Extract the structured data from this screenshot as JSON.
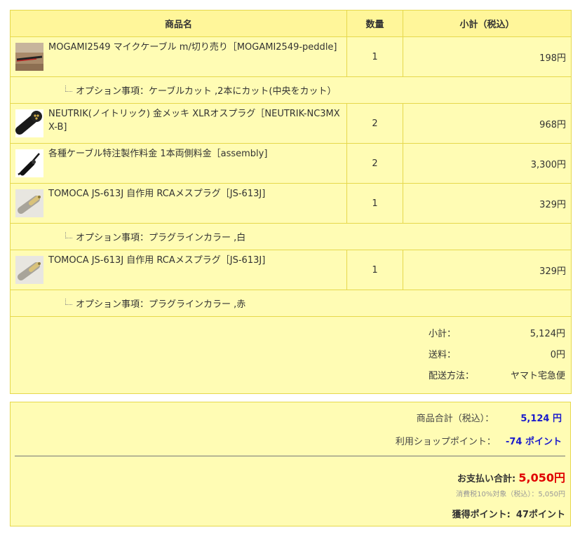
{
  "table": {
    "headers": {
      "name": "商品名",
      "qty": "数量",
      "subtotal": "小計（税込）"
    },
    "items": [
      {
        "name": "MOGAMI2549 マイクケーブル m/切り売り［MOGAMI2549-peddle]",
        "qty": "1",
        "subtotal": "198円",
        "thumb_icon": "red-cable-icon",
        "option": "オプション事項：ケーブルカット ,2本にカット(中央をカット）"
      },
      {
        "name": "NEUTRIK(ノイトリック) 金メッキ XLRオスプラグ［NEUTRIK-NC3MXX-B]",
        "qty": "2",
        "subtotal": "968円",
        "thumb_icon": "xlr-plug-icon"
      },
      {
        "name": "各種ケーブル特注製作料金 1本両側料金［assembly]",
        "qty": "2",
        "subtotal": "3,300円",
        "thumb_icon": "assembled-cable-icon"
      },
      {
        "name": "TOMOCA JS-613J 自作用 RCAメスプラグ［JS-613J]",
        "qty": "1",
        "subtotal": "329円",
        "thumb_icon": "rca-plug-icon",
        "option": "オプション事項：プラグラインカラー ,白"
      },
      {
        "name": "TOMOCA JS-613J 自作用 RCAメスプラグ［JS-613J]",
        "qty": "1",
        "subtotal": "329円",
        "thumb_icon": "rca-plug-icon",
        "option": "オプション事項：プラグラインカラー ,赤"
      }
    ],
    "totals": {
      "subtotal_label": "小計：",
      "subtotal_value": "5,124円",
      "shipping_label": "送料：",
      "shipping_value": "0円",
      "method_label": "配送方法：",
      "method_value": "ヤマト宅急便"
    }
  },
  "summary": {
    "goods_total_label": "商品合計（税込）：",
    "goods_total_value": "5,124 円",
    "points_used_label": "利用ショップポイント：",
    "points_used_value": "-74 ポイント",
    "payment_label": "お支払い合計:",
    "payment_value": "5,050円",
    "tax_note": "消費税10%対象（税込）：5,050円",
    "earned_label": "獲得ポイント:",
    "earned_value": "47ポイント"
  },
  "colors": {
    "table_bg": "#fffcb4",
    "header_bg": "#fff69a",
    "border": "#e6d84c",
    "accent_blue": "#1a1acc",
    "accent_red": "#e00000"
  }
}
